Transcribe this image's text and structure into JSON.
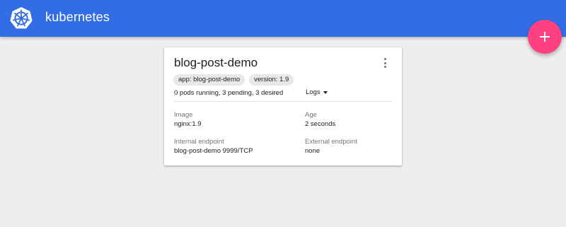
{
  "header": {
    "app_name": "kubernetes",
    "logo_icon": "kubernetes-helm-wheel-icon",
    "bar_color": "#326de6"
  },
  "fab": {
    "icon": "plus-icon",
    "color": "#ff4081"
  },
  "card": {
    "title": "blog-post-demo",
    "menu_icon": "more-vert-icon",
    "labels": [
      {
        "text": "app: blog-post-demo"
      },
      {
        "text": "version: 1.9"
      }
    ],
    "pod_status": "0 pods running, 3 pending, 3 desired",
    "logs_label": "Logs",
    "image_label": "Image",
    "image_value": "nginx:1.9",
    "age_label": "Age",
    "age_value": "2 seconds",
    "internal_endpoint_label": "Internal endpoint",
    "internal_endpoint_value": "blog-post-demo 9999/TCP",
    "external_endpoint_label": "External endpoint",
    "external_endpoint_value": "none"
  }
}
